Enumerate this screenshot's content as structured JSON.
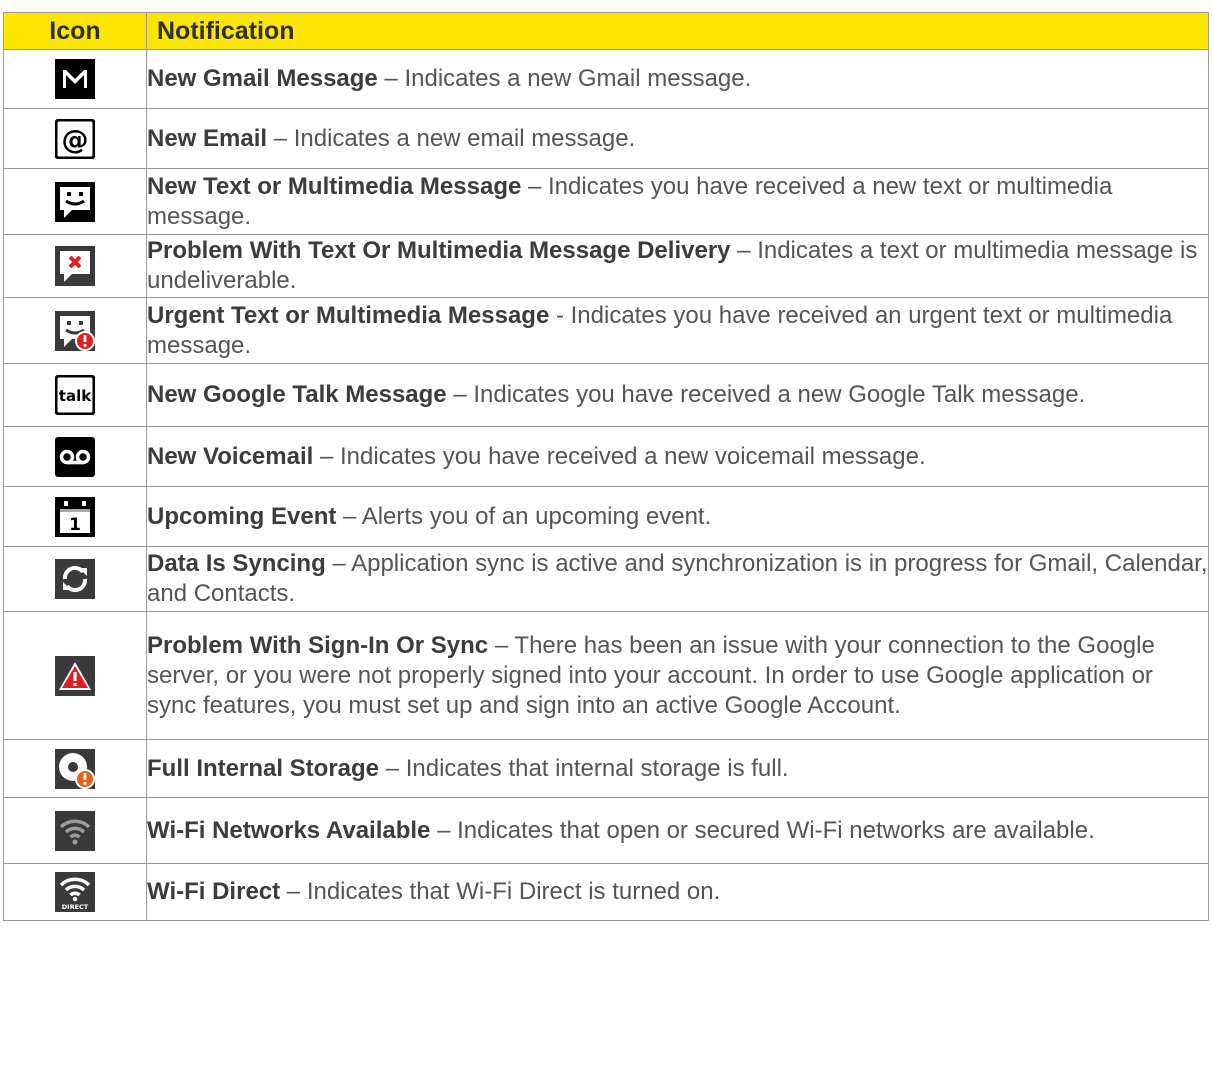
{
  "header": {
    "icon": "Icon",
    "notification": "Notification"
  },
  "rows": [
    {
      "icon": "gmail-icon",
      "title": "New Gmail Message",
      "sep": " – ",
      "desc": "Indicates a new Gmail message."
    },
    {
      "icon": "email-at-icon",
      "title": "New Email",
      "sep": " – ",
      "desc": "Indicates a new email message."
    },
    {
      "icon": "text-message-smiley-icon",
      "title": "New Text or Multimedia Message",
      "sep": " – ",
      "desc": "Indicates you have received a new text or multimedia message."
    },
    {
      "icon": "message-error-icon",
      "title": "Problem With Text Or Multimedia Message Delivery",
      "sep": " – ",
      "desc": "Indicates a text or multimedia message is undeliverable."
    },
    {
      "icon": "urgent-message-icon",
      "title": "Urgent Text or Multimedia Message",
      "sep": " - ",
      "desc": "Indicates you have received an urgent text or multimedia message."
    },
    {
      "icon": "google-talk-icon",
      "title": "New Google Talk Message",
      "sep": " – ",
      "desc": "Indicates you have received a new Google Talk message."
    },
    {
      "icon": "voicemail-icon",
      "title": "New Voicemail",
      "sep": " – ",
      "desc": "Indicates you have received a new voicemail message."
    },
    {
      "icon": "calendar-event-icon",
      "title": "Upcoming Event",
      "sep": " – ",
      "desc": "Alerts you of an upcoming event."
    },
    {
      "icon": "sync-icon",
      "title": "Data Is Syncing",
      "sep": " – ",
      "desc": "Application sync is active and synchronization is in progress for Gmail, Calendar, and Contacts."
    },
    {
      "icon": "sync-warning-icon",
      "title": "Problem With Sign-In Or Sync",
      "sep": " – ",
      "desc": "There has been an issue with your connection to the Google server, or you were not properly signed into your account. In order to use Google application or sync features, you must set up and sign into an active Google Account."
    },
    {
      "icon": "storage-full-icon",
      "title": "Full Internal Storage",
      "sep": " – ",
      "desc": "Indicates that internal storage is full."
    },
    {
      "icon": "wifi-networks-icon",
      "title": "Wi-Fi Networks Available",
      "sep": " – ",
      "desc": "Indicates that open or secured Wi-Fi networks are available."
    },
    {
      "icon": "wifi-direct-icon",
      "title": "Wi-Fi Direct",
      "sep": " – ",
      "desc": "Indicates that Wi-Fi Direct is turned on.",
      "icon_label": "DIRECT"
    }
  ]
}
